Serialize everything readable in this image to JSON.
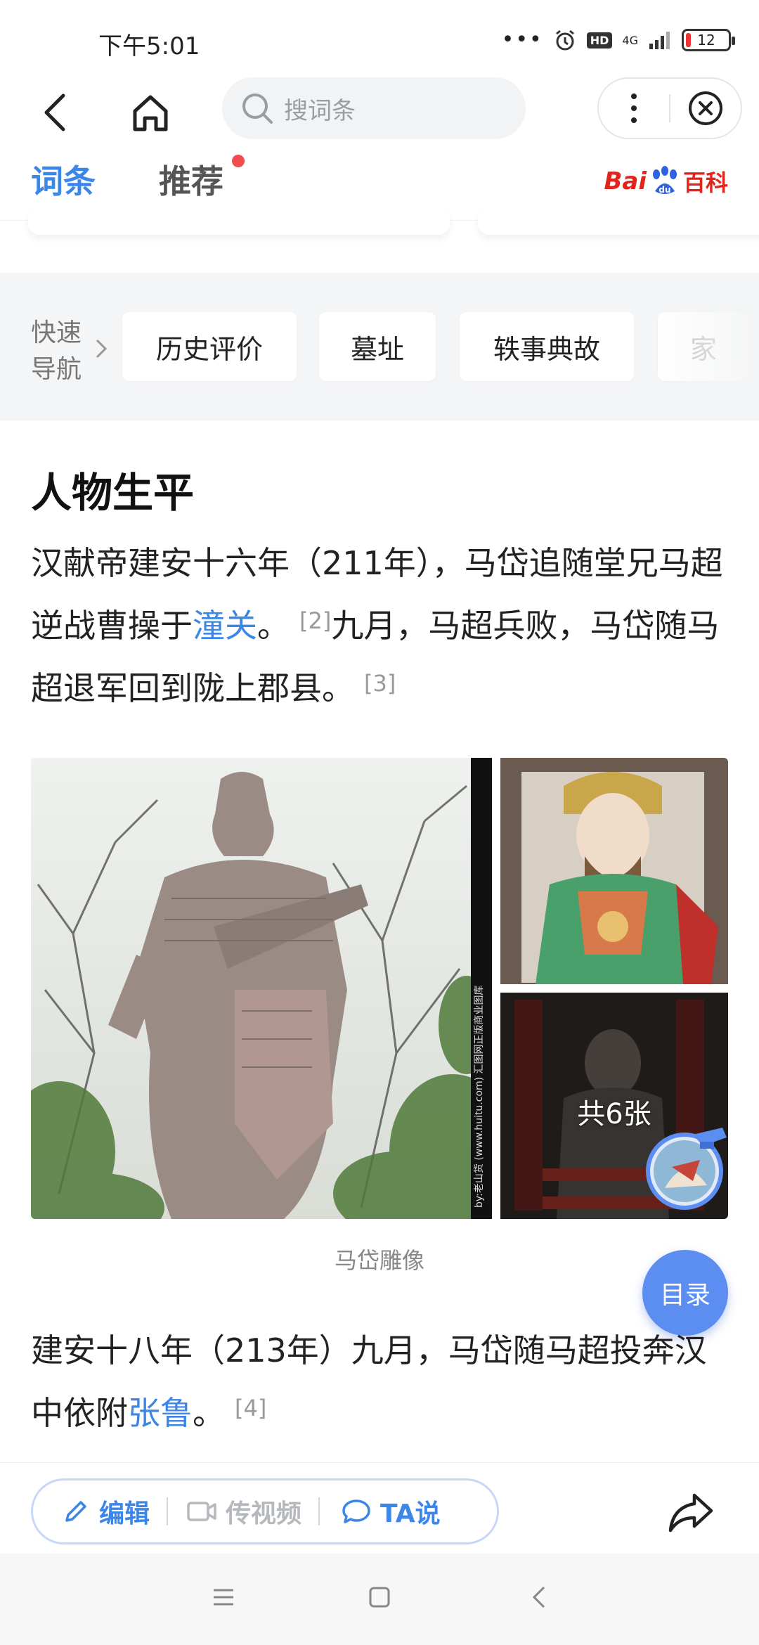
{
  "status_bar": {
    "time": "下午5:01",
    "network": "4G",
    "hd": "HD",
    "battery": "12",
    "icons": [
      "more-dots-icon",
      "alarm-icon",
      "hd-icon",
      "signal-icon",
      "battery-icon"
    ]
  },
  "nav": {
    "search_placeholder": "搜词条"
  },
  "tabs": {
    "entry": "词条",
    "recommend": "推荐",
    "brand_bai": "Bai",
    "brand_baike": "百科"
  },
  "quick_nav": {
    "label_line1": "快速",
    "label_line2": "导航",
    "items": [
      "历史评价",
      "墓址",
      "轶事典故",
      "家"
    ]
  },
  "section": {
    "title": "人物生平"
  },
  "para1": {
    "t1": "汉献帝建安十六年（211年），马岱追随堂兄马超逆战曹操于",
    "link": "潼关",
    "t2": "。",
    "ref1": "[2]",
    "t3": "九月，马超兵败，马岱随马超退军回到陇上郡县。",
    "ref2": "[3]"
  },
  "gallery": {
    "count_label": "共6张",
    "caption": "马岱雕像",
    "watermark": "by:老山货 (www.huitu.com) 汇图网正版商业图库"
  },
  "para2": {
    "t1": "建安十八年（213年）九月，马岱随马超投奔汉中依附",
    "link": "张鲁",
    "t2": "。",
    "ref": "[4]"
  },
  "toc_button": "目录",
  "toolbar": {
    "edit": "编辑",
    "video": "传视频",
    "ta": "TA说"
  },
  "colors": {
    "accent": "#3c86e8",
    "brand_red": "#e1251b",
    "toc_blue": "#5b8ef0"
  }
}
